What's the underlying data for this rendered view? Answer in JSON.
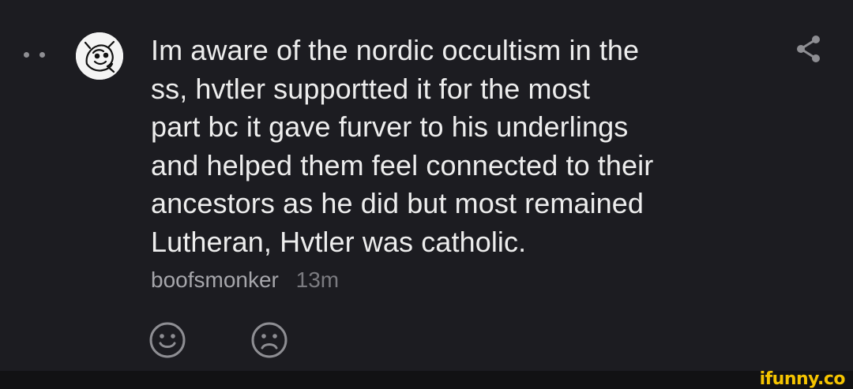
{
  "comment": {
    "lines": [
      "Im aware of the nordic occultism in the",
      "ss, hvtler supportted it for the most",
      "part bc it gave furver to his underlings",
      "and helped them feel connected to their",
      "ancestors as he did but most remained",
      "Lutheran, Hvtler was catholic."
    ],
    "username": "boofsmonker",
    "timestamp": "13m"
  },
  "icons": {
    "more": "more-dots-icon",
    "share": "share-icon",
    "react_positive": "smiley-face-icon",
    "react_negative": "sad-face-icon"
  },
  "colors": {
    "background": "#1c1c21",
    "text": "#ededed",
    "username": "#a6a6ab",
    "timestamp": "#7b7b80",
    "watermark": "#f5c400"
  },
  "watermark": {
    "text": "ifunny.co"
  }
}
